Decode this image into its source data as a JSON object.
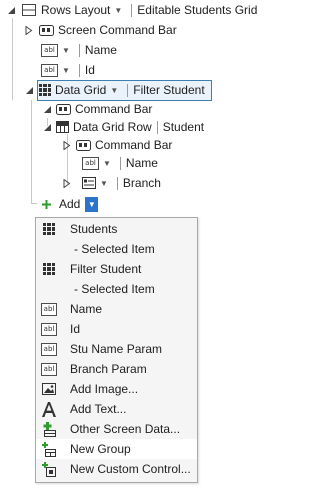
{
  "tree": {
    "root": {
      "label": "Rows Layout",
      "value": "Editable Students Grid"
    },
    "screen_command_bar": "Screen Command Bar",
    "name_field": "Name",
    "id_field": "Id",
    "data_grid": {
      "label": "Data Grid",
      "value": "Filter Student"
    },
    "grid_command_bar": "Command Bar",
    "data_grid_row": {
      "label": "Data Grid Row",
      "value": "Student"
    },
    "row_command_bar": "Command Bar",
    "row_name": "Name",
    "row_branch": "Branch",
    "add_label": "Add"
  },
  "menu": {
    "items": [
      {
        "label": "Students",
        "icon": "grid-icon"
      },
      {
        "label": "- Selected Item",
        "icon": ""
      },
      {
        "label": "Filter Student",
        "icon": "grid-icon"
      },
      {
        "label": "- Selected Item",
        "icon": ""
      },
      {
        "label": "Name",
        "icon": "abl-textbox-icon"
      },
      {
        "label": "Id",
        "icon": "abl-textbox-icon"
      },
      {
        "label": "Stu Name Param",
        "icon": "abl-textbox-icon"
      },
      {
        "label": "Branch Param",
        "icon": "abl-textbox-icon"
      },
      {
        "label": "Add Image...",
        "icon": "image-icon"
      },
      {
        "label": "Add Text...",
        "icon": "text-a-icon"
      },
      {
        "label": "Other Screen Data...",
        "icon": "other-data-icon"
      },
      {
        "label": "New Group",
        "icon": "new-group-icon"
      },
      {
        "label": "New Custom Control...",
        "icon": "custom-control-icon"
      }
    ],
    "hover_index": 11
  },
  "abl_text": "abl",
  "colors": {
    "accent": "#2a74c9",
    "selection_border": "#3c7fb1",
    "plus_green": "#2e9d2e"
  }
}
